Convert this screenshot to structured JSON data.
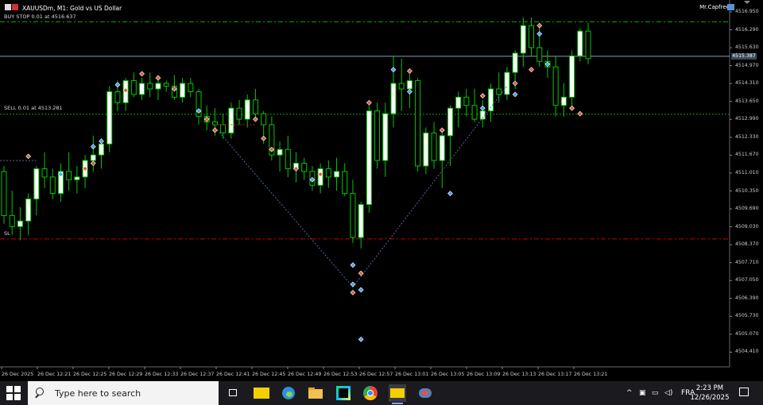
{
  "window": {
    "title": "XAUUSDm, M1:  Gold vs US Dollar",
    "account": "Mr.Capfree"
  },
  "orders": {
    "buy_stop": "BUY STOP 0.01 at 4516.637",
    "sell": "SELL 0.01 at 4513.281",
    "sl": "SL"
  },
  "price_axis": [
    "4516.950",
    "4516.290",
    "4515.630",
    "4514.970",
    "4514.310",
    "4513.650",
    "4512.990",
    "4512.330",
    "4511.670",
    "4511.010",
    "4510.350",
    "4509.690",
    "4509.030",
    "4508.370",
    "4507.710",
    "4507.050",
    "4506.390",
    "4505.730",
    "4505.070",
    "4504.410"
  ],
  "current_price_badge": "4515.387",
  "time_axis": [
    "26 Dec 2025",
    "26 Dec 12:21",
    "26 Dec 12:25",
    "26 Dec 12:29",
    "26 Dec 12:33",
    "26 Dec 12:37",
    "26 Dec 12:41",
    "26 Dec 12:45",
    "26 Dec 12:49",
    "26 Dec 12:53",
    "26 Dec 12:57",
    "26 Dec 13:01",
    "26 Dec 13:05",
    "26 Dec 13:09",
    "26 Dec 13:13",
    "26 Dec 13:17",
    "26 Dec 13:21"
  ],
  "colors": {
    "bull_body": "#ffffff",
    "wick": "#00c800",
    "buy_stop_line": "#00aa00",
    "sell_line": "#00aa00",
    "sl_line": "#cc0000",
    "bid_line": "#8ca0b4",
    "badge": "#3a4a5a"
  },
  "chart_data": {
    "type": "candlestick",
    "symbol": "XAUUSDm",
    "timeframe": "M1",
    "ylim": [
      4504.1,
      4517.2
    ],
    "levels": {
      "buy_stop": 4516.637,
      "sell": 4513.281,
      "sl": 4508.75,
      "bid": 4515.387
    },
    "candles": [
      [
        4511.2,
        4511.4,
        4509.3,
        4509.6
      ],
      [
        4509.6,
        4510.5,
        4508.9,
        4509.2
      ],
      [
        4509.2,
        4509.9,
        4508.7,
        4509.4
      ],
      [
        4509.4,
        4510.4,
        4508.9,
        4510.2
      ],
      [
        4510.2,
        4511.4,
        4509.6,
        4511.3
      ],
      [
        4511.3,
        4511.9,
        4510.6,
        4511.0
      ],
      [
        4511.0,
        4511.3,
        4510.2,
        4510.4
      ],
      [
        4510.4,
        4511.5,
        4510.1,
        4511.2
      ],
      [
        4511.2,
        4511.9,
        4510.5,
        4510.9
      ],
      [
        4510.9,
        4511.4,
        4510.4,
        4511.0
      ],
      [
        4511.0,
        4511.8,
        4510.6,
        4511.6
      ],
      [
        4511.6,
        4512.5,
        4511.2,
        4511.8
      ],
      [
        4511.8,
        4512.4,
        4511.3,
        4512.2
      ],
      [
        4512.2,
        4514.3,
        4511.9,
        4514.1
      ],
      [
        4514.1,
        4514.5,
        4513.4,
        4513.7
      ],
      [
        4513.7,
        4514.6,
        4513.4,
        4514.5
      ],
      [
        4514.5,
        4514.8,
        4513.9,
        4514.0
      ],
      [
        4514.0,
        4514.6,
        4513.8,
        4514.4
      ],
      [
        4514.4,
        4514.8,
        4513.9,
        4514.2
      ],
      [
        4514.2,
        4514.6,
        4513.8,
        4514.4
      ],
      [
        4514.4,
        4514.5,
        4514.1,
        4514.3
      ],
      [
        4514.3,
        4514.7,
        4513.8,
        4513.9
      ],
      [
        4513.9,
        4514.6,
        4513.7,
        4514.4
      ],
      [
        4514.4,
        4514.6,
        4513.9,
        4514.1
      ],
      [
        4514.1,
        4514.2,
        4512.9,
        4513.2
      ],
      [
        4513.2,
        4513.6,
        4512.7,
        4513.0
      ],
      [
        4513.0,
        4513.5,
        4512.5,
        4512.9
      ],
      [
        4512.9,
        4513.3,
        4512.4,
        4512.6
      ],
      [
        4512.6,
        4513.7,
        4512.4,
        4513.5
      ],
      [
        4513.5,
        4513.8,
        4512.9,
        4513.1
      ],
      [
        4513.1,
        4514.0,
        4512.8,
        4513.8
      ],
      [
        4513.8,
        4514.2,
        4513.1,
        4513.3
      ],
      [
        4513.3,
        4513.4,
        4512.2,
        4512.9
      ],
      [
        4512.9,
        4513.2,
        4511.6,
        4511.8
      ],
      [
        4511.8,
        4512.3,
        4511.2,
        4512.0
      ],
      [
        4512.0,
        4512.5,
        4511.0,
        4511.3
      ],
      [
        4511.3,
        4511.9,
        4510.8,
        4511.5
      ],
      [
        4511.5,
        4511.7,
        4510.9,
        4511.2
      ],
      [
        4511.2,
        4511.4,
        4510.5,
        4510.7
      ],
      [
        4510.7,
        4511.5,
        4510.4,
        4511.3
      ],
      [
        4511.3,
        4511.6,
        4510.6,
        4511.0
      ],
      [
        4511.0,
        4511.7,
        4510.5,
        4511.2
      ],
      [
        4511.2,
        4511.5,
        4510.3,
        4510.4
      ],
      [
        4510.4,
        4510.9,
        4508.6,
        4508.8
      ],
      [
        4508.8,
        4510.1,
        4508.4,
        4510.0
      ],
      [
        4510.0,
        4513.6,
        4509.7,
        4513.4
      ],
      [
        4513.4,
        4513.7,
        4511.3,
        4511.6
      ],
      [
        4511.6,
        4513.7,
        4511.0,
        4513.3
      ],
      [
        4513.3,
        4515.4,
        4512.8,
        4514.4
      ],
      [
        4514.4,
        4515.3,
        4513.4,
        4514.2
      ],
      [
        4514.2,
        4514.8,
        4513.5,
        4514.5
      ],
      [
        4514.5,
        4514.6,
        4511.2,
        4511.4
      ],
      [
        4511.4,
        4512.8,
        4511.1,
        4512.6
      ],
      [
        4512.6,
        4513.0,
        4511.3,
        4511.6
      ],
      [
        4511.6,
        4512.6,
        4510.6,
        4512.5
      ],
      [
        4512.5,
        4513.6,
        4511.4,
        4513.5
      ],
      [
        4513.5,
        4514.1,
        4512.8,
        4513.9
      ],
      [
        4513.9,
        4514.2,
        4513.2,
        4513.6
      ],
      [
        4513.6,
        4514.2,
        4513.0,
        4513.1
      ],
      [
        4513.1,
        4513.8,
        4512.8,
        4513.4
      ],
      [
        4513.4,
        4514.4,
        4513.0,
        4514.2
      ],
      [
        4514.2,
        4514.8,
        4513.7,
        4514.0
      ],
      [
        4514.0,
        4515.0,
        4513.8,
        4514.8
      ],
      [
        4514.8,
        4515.6,
        4514.2,
        4515.5
      ],
      [
        4515.5,
        4516.8,
        4515.0,
        4516.5
      ],
      [
        4516.5,
        4516.8,
        4515.4,
        4515.7
      ],
      [
        4515.7,
        4516.6,
        4515.0,
        4515.2
      ],
      [
        4515.2,
        4515.6,
        4514.6,
        4515.0
      ],
      [
        4515.0,
        4515.4,
        4513.2,
        4513.6
      ],
      [
        4513.6,
        4514.4,
        4513.2,
        4513.9
      ],
      [
        4513.9,
        4515.6,
        4513.6,
        4515.4
      ],
      [
        4515.4,
        4516.4,
        4515.2,
        4516.3
      ],
      [
        4516.3,
        4516.6,
        4515.1,
        4515.3
      ]
    ]
  },
  "taskbar": {
    "search_placeholder": "Type here to search",
    "language": "FRA",
    "time": "2:23 PM",
    "date": "12/26/2025"
  }
}
